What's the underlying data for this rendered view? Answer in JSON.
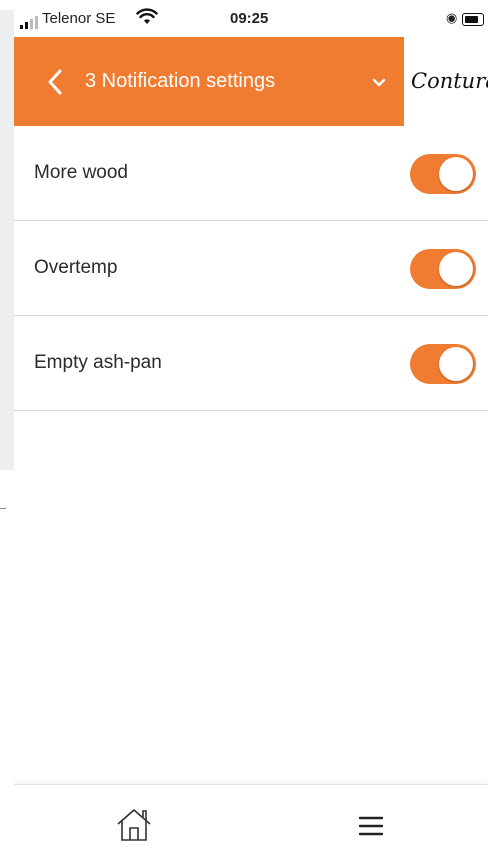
{
  "status_bar": {
    "carrier": "Telenor SE",
    "time": "09:25",
    "icons": [
      "signal-icon",
      "wifi-icon",
      "orientation-lock-icon",
      "battery-icon"
    ]
  },
  "header": {
    "title": "3 Notification settings",
    "brand": "Contura",
    "icons": [
      "back-chevron-icon",
      "chevron-down-icon"
    ]
  },
  "settings": [
    {
      "label": "More wood",
      "enabled": true
    },
    {
      "label": "Overtemp",
      "enabled": true
    },
    {
      "label": "Empty ash-pan",
      "enabled": true
    }
  ],
  "bottom_nav": {
    "icons": [
      "home-icon",
      "hamburger-menu-icon"
    ]
  },
  "colors": {
    "accent": "#f07c31",
    "background": "#ffffff",
    "divider": "#d8d8d8"
  }
}
